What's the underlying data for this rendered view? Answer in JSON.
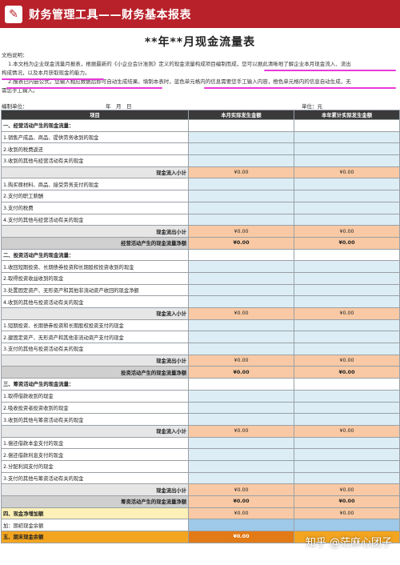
{
  "header": {
    "title": "财务管理工具——财务基本报表",
    "logo_icon": "wrench-icon"
  },
  "main_title": "**年**月现金流量表",
  "notes": {
    "heading": "文档说明：",
    "line1": "1.本文档为企业现金流量月报表，根据最新的《小企业会计准则》定义的现金流量构成项目编制而成，您可以据此清晰地了解企业本月现金流入、流出",
    "line2": "构成情况，以及本月获取现金的能力。",
    "line3": "2.报表已内嵌公式，您输入相应数据后即可自动生成结果。填制本表时，蓝色单元格内的信息需要您手工输入内容，橙色单元格内的信息自动生成，无",
    "line4": "需您手工输入。"
  },
  "meta": {
    "unit": "编制单位：",
    "date": "年　月　日",
    "currency": "单位：元"
  },
  "columns": [
    "项目",
    "本月实际发生金额",
    "本年累计实际发生金额"
  ],
  "rows": [
    {
      "t": "sec",
      "label": "一、经营活动产生的现金流量："
    },
    {
      "t": "in",
      "label": "1.销售产成品、商品、提供劳务收到的现金"
    },
    {
      "t": "in",
      "label": "2.收到的税费返还"
    },
    {
      "t": "in",
      "label": "3.收到的其他与经营活动有关的现金"
    },
    {
      "t": "sub",
      "label": "现金流入小计",
      "v1": "¥0.00",
      "v2": "¥0.00"
    },
    {
      "t": "in",
      "label": "1.购买原材料、商品、接受劳务支付的现金"
    },
    {
      "t": "in",
      "label": "2.支付的职工薪酬"
    },
    {
      "t": "in",
      "label": "3.支付的税费"
    },
    {
      "t": "in",
      "label": "4.支付的其他与经营活动有关的现金"
    },
    {
      "t": "sub",
      "label": "现金流出小计",
      "v1": "¥0.00",
      "v2": "¥0.00"
    },
    {
      "t": "net",
      "label": "经营活动产生的现金流量净额",
      "v1": "¥0.00",
      "v2": "¥0.00"
    },
    {
      "t": "sec",
      "label": "二、投资活动产生的现金流量："
    },
    {
      "t": "in",
      "label": "1.收回短期投资、长期债券投资和长期股权投资收到的现金"
    },
    {
      "t": "in",
      "label": "2.取得投资收益收到的现金"
    },
    {
      "t": "in",
      "label": "3.处置固定资产、无形资产和其他非流动资产收回的现金净额"
    },
    {
      "t": "in",
      "label": "4.收到的其他与投资活动有关的现金"
    },
    {
      "t": "sub",
      "label": "现金流入小计",
      "v1": "¥0.00",
      "v2": "¥0.00"
    },
    {
      "t": "in",
      "label": "1.短期投资、长期债券投资和长期股权投资支付的现金"
    },
    {
      "t": "in",
      "label": "2.建固定资产、无形资产和其他非流动资产支付的现金"
    },
    {
      "t": "in",
      "label": "3.支付的其他与投资活动有关的现金"
    },
    {
      "t": "sub",
      "label": "现金流出小计",
      "v1": "¥0.00",
      "v2": "¥0.00"
    },
    {
      "t": "net",
      "label": "投资活动产生的现金流量净额",
      "v1": "¥0.00",
      "v2": "¥0.00"
    },
    {
      "t": "sec",
      "label": "三、筹资活动产生的现金流量："
    },
    {
      "t": "in",
      "label": "1.取得借款收到的现金"
    },
    {
      "t": "in",
      "label": "2.吸收投资者投资收到的现金"
    },
    {
      "t": "in",
      "label": "3.收到的其他与筹资活动有关的现金"
    },
    {
      "t": "sub",
      "label": "现金流入小计",
      "v1": "¥0.00",
      "v2": "¥0.00"
    },
    {
      "t": "in",
      "label": "1.偿还借款本金支付的现金"
    },
    {
      "t": "in",
      "label": "2.偿还借款利息支付的现金"
    },
    {
      "t": "in",
      "label": "2.分配利润支付的现金"
    },
    {
      "t": "in",
      "label": "3.支付的其他与筹资活动有关的现金"
    },
    {
      "t": "sub",
      "label": "现金流出小计",
      "v1": "¥0.00",
      "v2": "¥0.00"
    },
    {
      "t": "net",
      "label": "筹资活动产生的现金流量净额",
      "v1": "¥0.00",
      "v2": "¥0.00"
    },
    {
      "t": "inc",
      "label": "四、现金净增加额",
      "v1": "¥0.00",
      "v2": "¥0.00"
    },
    {
      "t": "beg",
      "label": "加：期初现金余额"
    },
    {
      "t": "fin",
      "label": "五、期末现金余额",
      "v1": "¥0.00"
    }
  ],
  "watermark": "知乎 @茫麻心团子",
  "colors": {
    "header_red": "#b8212a",
    "input_blue": "#dcedf5",
    "auto_orange": "#f8c9a4",
    "final_orange": "#e27a16"
  }
}
